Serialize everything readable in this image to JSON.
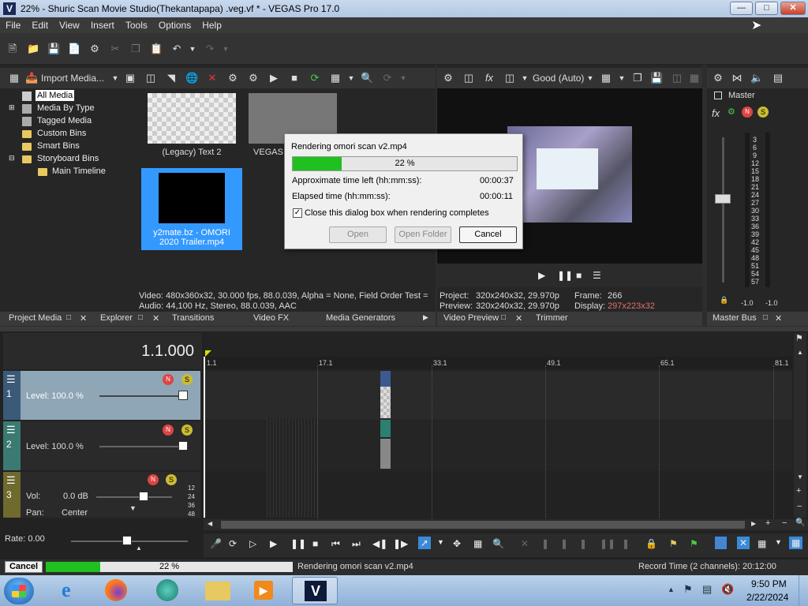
{
  "window": {
    "title": "22% - Shuric Scan Movie Studio(Thekantapapa) .veg.vf * - VEGAS Pro 17.0",
    "app_icon": "V"
  },
  "menu": [
    "File",
    "Edit",
    "View",
    "Insert",
    "Tools",
    "Options",
    "Help"
  ],
  "media": {
    "import_label": "Import Media...",
    "tree": [
      "All Media",
      "Media By Type",
      "Tagged Media",
      "Custom Bins",
      "Smart Bins",
      "Storyboard Bins",
      "Main Timeline"
    ],
    "thumbs": [
      "(Legacy) Text 2",
      "VEGAS",
      "y2mate.bz - OMORI 2020 Trailer.mp4"
    ],
    "info_video": "Video: 480x360x32, 30.000 fps, 88.0.039, Alpha = None, Field Order Test =",
    "info_audio": "Audio: 44,100 Hz, Stereo, 88.0.039, AAC"
  },
  "tabs_left": [
    "Project Media",
    "Explorer",
    "Transitions",
    "Video FX",
    "Media Generators"
  ],
  "preview": {
    "quality": "Good (Auto)",
    "project_label": "Project:",
    "project_value": "320x240x32, 29.970p",
    "preview_label": "Preview:",
    "preview_value": "320x240x32, 29.970p",
    "frame_label": "Frame:",
    "frame_value": "266",
    "display_label": "Display:",
    "display_value": "297x223x32",
    "tabs": [
      "Video Preview",
      "Trimmer"
    ]
  },
  "master": {
    "title": "Master",
    "scale": [
      "3",
      "6",
      "9",
      "12",
      "15",
      "18",
      "21",
      "24",
      "27",
      "30",
      "33",
      "36",
      "39",
      "42",
      "45",
      "48",
      "51",
      "54",
      "57"
    ],
    "readout_left": "-1.0",
    "readout_right": "-1.0",
    "tab": "Master Bus"
  },
  "dialog": {
    "title": "Rendering omori scan v2.mp4",
    "progress_text": "22 %",
    "progress": 0.22,
    "time_left_label": "Approximate time left (hh:mm:ss):",
    "time_left": "00:00:37",
    "elapsed_label": "Elapsed time (hh:mm:ss):",
    "elapsed": "00:00:11",
    "checkbox_label": "Close this dialog box when rendering completes",
    "open": "Open",
    "open_folder": "Open Folder",
    "cancel": "Cancel"
  },
  "timeline": {
    "time": "1.1.000",
    "ruler": [
      "1.1",
      "17.1",
      "33.1",
      "49.1",
      "65.1",
      "81.1"
    ],
    "track1": {
      "num": "1",
      "level": "Level: 100.0 %"
    },
    "track2": {
      "num": "2",
      "level": "Level: 100.0 %"
    },
    "track3": {
      "num": "3",
      "vol_label": "Vol:",
      "vol": "0.0 dB",
      "pan_label": "Pan:",
      "pan": "Center",
      "scale": [
        "12",
        "24",
        "36",
        "48"
      ]
    },
    "rate": "Rate: 0.00"
  },
  "status": {
    "cancel": "Cancel",
    "progress_text": "22 %",
    "progress": 0.22,
    "message": "Rendering omori scan v2.mp4",
    "record_time": "Record Time (2 channels): 20:12:00"
  },
  "taskbar": {
    "time": "9:50 PM",
    "date": "2/22/2024"
  },
  "colors": {
    "accent_green": "#21c021",
    "track1": "#3a5a78",
    "track2": "#3b7a72",
    "track3": "#6f6a2e"
  }
}
